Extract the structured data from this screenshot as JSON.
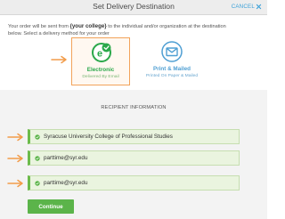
{
  "header": {
    "title": "Set Delivery Destination",
    "cancel_label": "CANCEL"
  },
  "intro": {
    "prefix": "Your order will be sent from",
    "college": "{your college}",
    "line1_suffix": "to the individual and/or organization at the destination",
    "line2": "below. Select a delivery method for your order"
  },
  "options": [
    {
      "label": "Electronic",
      "sub": "Delivered By Email",
      "selected": true,
      "icon": "e-delivery-check-icon",
      "color": "#2aa84a"
    },
    {
      "label": "Print & Mailed",
      "sub": "Printed On Paper & Mailed",
      "selected": false,
      "icon": "envelope-icon",
      "color": "#4f9fd3"
    }
  ],
  "recipient": {
    "title": "RECIPIENT INFORMATION",
    "fields": [
      {
        "value": "Syracuse University College of Professional Studies"
      },
      {
        "value": "parttime@syr.edu"
      },
      {
        "value": "parttime@syr.edu"
      }
    ]
  },
  "continue_label": "Continue",
  "colors": {
    "accent_green": "#5bb44a",
    "highlight_orange": "#f2a35a",
    "link_blue": "#3aa0d8"
  }
}
